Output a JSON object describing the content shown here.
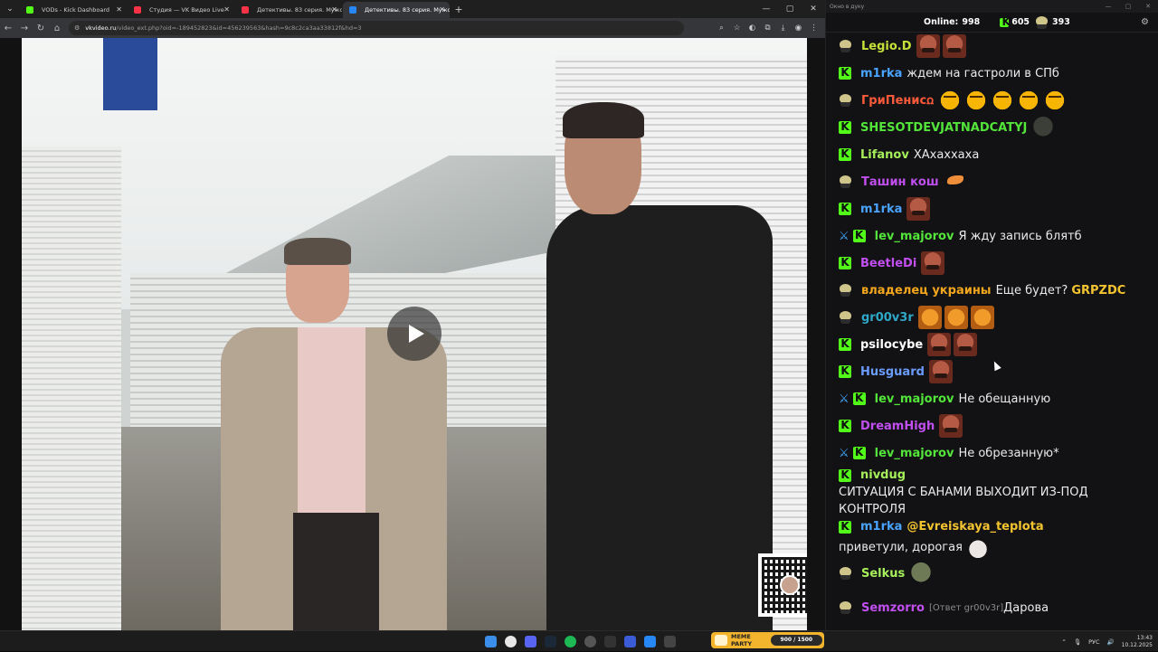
{
  "browser": {
    "tabs": [
      {
        "label": "VODs - Kick Dashboard",
        "favicon_color": "#53fc18",
        "active": false
      },
      {
        "label": "Студия — VK Видео Live",
        "favicon_color": "#ff3347",
        "active": false
      },
      {
        "label": "Детективы. 83 серия. Мужско",
        "favicon_color": "#ff3347",
        "active": false
      },
      {
        "label": "Детективы. 83 серия. Мужско",
        "favicon_color": "#2787f5",
        "active": true
      }
    ],
    "url_host": "vkvideo.ru",
    "url_path": "/video_ext.php?oid=-189452823&id=456239563&hash=9c8c2ca3aa33812f&hd=3"
  },
  "video": {
    "play_icon": "play-icon",
    "qr_icon": "qr-code"
  },
  "chat": {
    "window_title": "Окно в дуку",
    "online_label": "Online:",
    "online_count": "998",
    "kick_count": "605",
    "skull_count": "393",
    "messages": [
      {
        "badges": [
          "skull"
        ],
        "user": "Legio.D",
        "color": "#c6e03a",
        "text": "",
        "emotes": [
          "face",
          "face"
        ]
      },
      {
        "badges": [
          "kick"
        ],
        "user": "m1rka",
        "color": "#4aa3ff",
        "text": "ждем на гастроли в СПб",
        "emotes": []
      },
      {
        "badges": [
          "skull"
        ],
        "user": "ГриПенисꭥ",
        "color": "#ff5a3c",
        "text": "",
        "emotes": [
          "cry",
          "cry",
          "cry",
          "cry",
          "cry"
        ]
      },
      {
        "badges": [
          "kick"
        ],
        "user": "SHESOTDEVJATNADCATYJ",
        "color": "#53e53a",
        "text": "",
        "emotes": [
          "dark"
        ]
      },
      {
        "badges": [
          "kick"
        ],
        "user": "Lifanov",
        "color": "#a6ef5a",
        "text": "ХАхаххаха",
        "emotes": []
      },
      {
        "badges": [
          "skull"
        ],
        "user": "Ташин кош",
        "color": "#c14ff0",
        "text": "",
        "emotes": [
          "fox"
        ]
      },
      {
        "badges": [
          "kick"
        ],
        "user": "m1rka",
        "color": "#4aa3ff",
        "text": "",
        "emotes": [
          "face"
        ]
      },
      {
        "badges": [
          "sword",
          "kick"
        ],
        "user": "lev_majorov",
        "color": "#53e53a",
        "text": "Я жду запись блятб",
        "emotes": []
      },
      {
        "badges": [
          "kick"
        ],
        "user": "BeetleDi",
        "color": "#c14ff0",
        "text": "",
        "emotes": [
          "face"
        ]
      },
      {
        "badges": [
          "skull"
        ],
        "user": "владелец украины",
        "color": "#f4a71c",
        "text": "Еще будет?",
        "highlight": "GRPZDC",
        "emotes": []
      },
      {
        "badges": [
          "skull"
        ],
        "user": "gr00v3r",
        "color": "#2ea8c8",
        "text": "",
        "emotes": [
          "tiger",
          "tiger",
          "tiger"
        ]
      },
      {
        "badges": [
          "kick"
        ],
        "user": "psilocybe",
        "color": "#ffffff",
        "text": "",
        "emotes": [
          "face",
          "face"
        ]
      },
      {
        "badges": [
          "kick"
        ],
        "user": "Husguard",
        "color": "#6a9cff",
        "text": "",
        "emotes": [
          "face"
        ]
      },
      {
        "badges": [
          "sword",
          "kick"
        ],
        "user": "lev_majorov",
        "color": "#53e53a",
        "text": "Не обещанную",
        "emotes": []
      },
      {
        "badges": [
          "kick"
        ],
        "user": "DreamHigh",
        "color": "#c14ff0",
        "text": "",
        "emotes": [
          "face"
        ]
      },
      {
        "badges": [
          "sword",
          "kick"
        ],
        "user": "lev_majorov",
        "color": "#53e53a",
        "text": "Не обрезанную*",
        "emotes": []
      },
      {
        "badges": [
          "kick"
        ],
        "user": "nivdug",
        "color": "#a6ef5a",
        "text": "СИТУАЦИЯ С БАНАМИ ВЫХОДИТ ИЗ-ПОД КОНТРОЛЯ",
        "emotes": [],
        "tall": true
      },
      {
        "badges": [
          "kick"
        ],
        "user": "m1rka",
        "color": "#4aa3ff",
        "mention": "@Evreiskaya_teplota",
        "text": "приветули, дорогая",
        "emotes": [
          "cat"
        ],
        "tall": true
      },
      {
        "badges": [
          "skull"
        ],
        "user": "Selkus",
        "color": "#a6ef5a",
        "text": "",
        "emotes": [
          "green"
        ]
      },
      {
        "badges": [
          "skull"
        ],
        "user": "Semzorro",
        "color": "#c14ff0",
        "reply": "[Ответ gr00v3r]",
        "text": "Дарова",
        "emotes": [],
        "tall": true
      }
    ]
  },
  "taskbar": {
    "widget_title": "MEME PARTY",
    "widget_progress": "900 / 1500",
    "lang": "РУС",
    "time": "13:43",
    "date": "10.12.2025"
  }
}
